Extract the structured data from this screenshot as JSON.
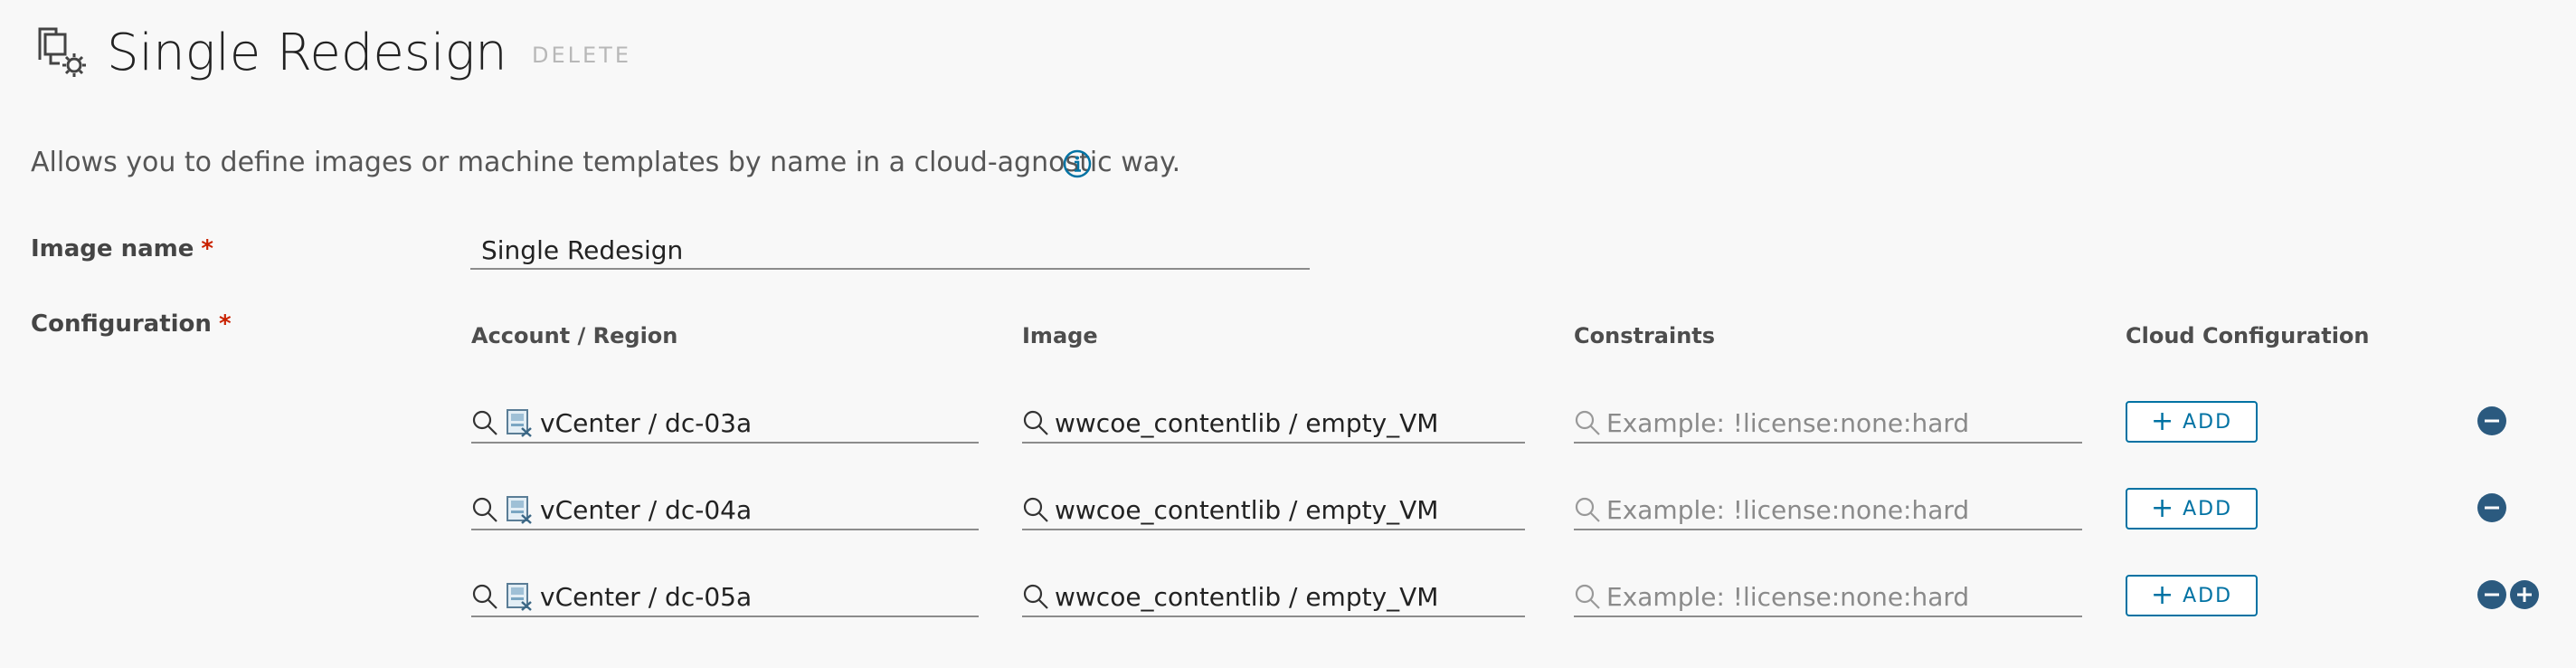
{
  "header": {
    "title": "Single Redesign",
    "delete_label": "DELETE",
    "page_icon": "image-profile-gear-icon"
  },
  "description": "Allows you to define images or machine templates by name in a cloud-agnostic way.",
  "form": {
    "image_name_label": "Image name",
    "image_name_value": "Single Redesign",
    "configuration_label": "Configuration",
    "required_marker": "*"
  },
  "columns": [
    "Account / Region",
    "Image",
    "Constraints",
    "Cloud Configuration"
  ],
  "rows": [
    {
      "account_region": "vCenter / dc-03a",
      "image": "wwcoe_contentlib / empty_VM",
      "constraints_placeholder": "Example: !license:none:hard",
      "add_label": "ADD"
    },
    {
      "account_region": "vCenter / dc-04a",
      "image": "wwcoe_contentlib / empty_VM",
      "constraints_placeholder": "Example: !license:none:hard",
      "add_label": "ADD"
    },
    {
      "account_region": "vCenter / dc-05a",
      "image": "wwcoe_contentlib / empty_VM",
      "constraints_placeholder": "Example: !license:none:hard",
      "add_label": "ADD"
    }
  ],
  "colors": {
    "accent": "#0072a3",
    "round_button": "#2b5a7f",
    "required": "#c92100"
  }
}
